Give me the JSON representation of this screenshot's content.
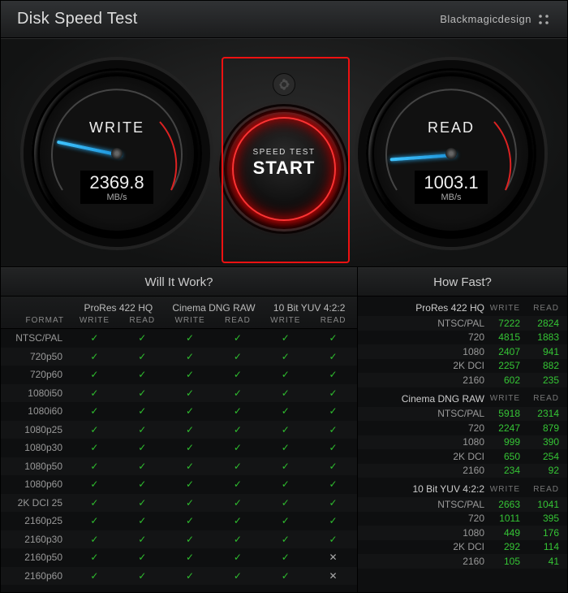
{
  "title": "Disk Speed Test",
  "brand": "Blackmagicdesign",
  "start": {
    "line1": "SPEED TEST",
    "line2": "START"
  },
  "gauges": {
    "write": {
      "label": "WRITE",
      "value": "2369.8",
      "unit": "MB/s",
      "needle_deg": 12
    },
    "read": {
      "label": "READ",
      "value": "1003.1",
      "unit": "MB/s",
      "needle_deg": -4
    }
  },
  "left": {
    "heading": "Will It Work?",
    "format_header": "FORMAT",
    "wr_labels": {
      "w": "WRITE",
      "r": "READ"
    },
    "groups": [
      "ProRes 422 HQ",
      "Cinema DNG RAW",
      "10 Bit YUV 4:2:2"
    ],
    "rows": [
      {
        "fmt": "NTSC/PAL",
        "v": [
          1,
          1,
          1,
          1,
          1,
          1
        ]
      },
      {
        "fmt": "720p50",
        "v": [
          1,
          1,
          1,
          1,
          1,
          1
        ]
      },
      {
        "fmt": "720p60",
        "v": [
          1,
          1,
          1,
          1,
          1,
          1
        ]
      },
      {
        "fmt": "1080i50",
        "v": [
          1,
          1,
          1,
          1,
          1,
          1
        ]
      },
      {
        "fmt": "1080i60",
        "v": [
          1,
          1,
          1,
          1,
          1,
          1
        ]
      },
      {
        "fmt": "1080p25",
        "v": [
          1,
          1,
          1,
          1,
          1,
          1
        ]
      },
      {
        "fmt": "1080p30",
        "v": [
          1,
          1,
          1,
          1,
          1,
          1
        ]
      },
      {
        "fmt": "1080p50",
        "v": [
          1,
          1,
          1,
          1,
          1,
          1
        ]
      },
      {
        "fmt": "1080p60",
        "v": [
          1,
          1,
          1,
          1,
          1,
          1
        ]
      },
      {
        "fmt": "2K DCI 25",
        "v": [
          1,
          1,
          1,
          1,
          1,
          1
        ]
      },
      {
        "fmt": "2160p25",
        "v": [
          1,
          1,
          1,
          1,
          1,
          1
        ]
      },
      {
        "fmt": "2160p30",
        "v": [
          1,
          1,
          1,
          1,
          1,
          1
        ]
      },
      {
        "fmt": "2160p50",
        "v": [
          1,
          1,
          1,
          1,
          1,
          0
        ]
      },
      {
        "fmt": "2160p60",
        "v": [
          1,
          1,
          1,
          1,
          1,
          0
        ]
      }
    ]
  },
  "right": {
    "heading": "How Fast?",
    "wr_labels": {
      "w": "WRITE",
      "r": "READ"
    },
    "groups": [
      {
        "name": "ProRes 422 HQ",
        "rows": [
          {
            "lbl": "NTSC/PAL",
            "w": "7222",
            "r": "2824"
          },
          {
            "lbl": "720",
            "w": "4815",
            "r": "1883"
          },
          {
            "lbl": "1080",
            "w": "2407",
            "r": "941"
          },
          {
            "lbl": "2K DCI",
            "w": "2257",
            "r": "882"
          },
          {
            "lbl": "2160",
            "w": "602",
            "r": "235"
          }
        ]
      },
      {
        "name": "Cinema DNG RAW",
        "rows": [
          {
            "lbl": "NTSC/PAL",
            "w": "5918",
            "r": "2314"
          },
          {
            "lbl": "720",
            "w": "2247",
            "r": "879"
          },
          {
            "lbl": "1080",
            "w": "999",
            "r": "390"
          },
          {
            "lbl": "2K DCI",
            "w": "650",
            "r": "254"
          },
          {
            "lbl": "2160",
            "w": "234",
            "r": "92"
          }
        ]
      },
      {
        "name": "10 Bit YUV 4:2:2",
        "rows": [
          {
            "lbl": "NTSC/PAL",
            "w": "2663",
            "r": "1041"
          },
          {
            "lbl": "720",
            "w": "1011",
            "r": "395"
          },
          {
            "lbl": "1080",
            "w": "449",
            "r": "176"
          },
          {
            "lbl": "2K DCI",
            "w": "292",
            "r": "114"
          },
          {
            "lbl": "2160",
            "w": "105",
            "r": "41"
          }
        ]
      }
    ]
  }
}
